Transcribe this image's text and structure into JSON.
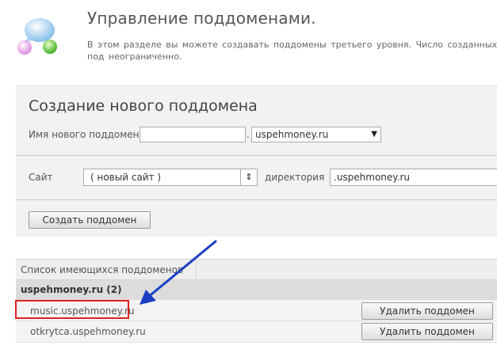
{
  "header": {
    "title": "Управление поддоменами.",
    "description": "В этом разделе вы можете создавать поддомены третьего уровня. Число созданных под неограниченно."
  },
  "create_form": {
    "title": "Создание нового поддомена",
    "subdomain_label": "Имя нового поддомена",
    "subdomain_value": "",
    "dot": ".",
    "domain_selected": "uspehmoney.ru",
    "site_label": "Сайт",
    "site_selected": "( новый сайт )",
    "directory_label": "директория",
    "directory_value": ".uspehmoney.ru",
    "submit_label": "Создать поддомен"
  },
  "list": {
    "header": "Список имеющихся поддоменов",
    "group": "uspehmoney.ru (2)",
    "items": [
      {
        "name": "music.uspehmoney.ru",
        "delete_label": "Удалить поддомен"
      },
      {
        "name": "otkrytca.uspehmoney.ru",
        "delete_label": "Удалить поддомен"
      }
    ]
  },
  "colors": {
    "highlight": "#e02020",
    "arrow": "#1a3fc4"
  },
  "icons": {
    "logo": "colored-bubbles-icon",
    "select_arrow": "triangle-down-icon",
    "site_select_arrow": "double-arrow-icon"
  }
}
